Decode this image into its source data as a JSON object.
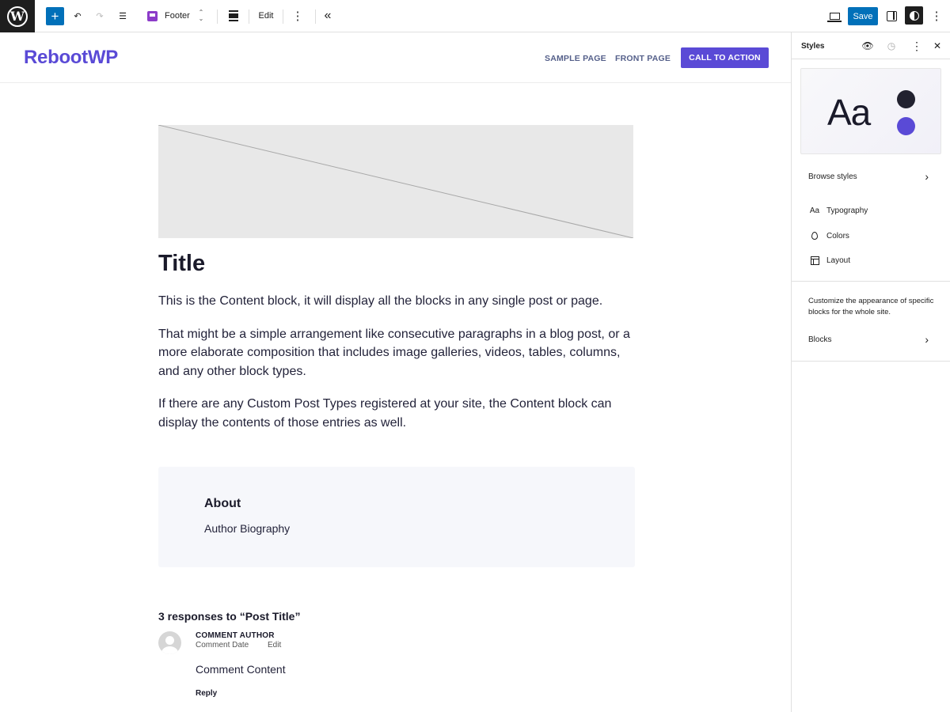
{
  "toolbar": {
    "add_label": "+",
    "undo_icon": "↶",
    "redo_icon": "↷",
    "list_view_icon": "☰",
    "document_title": "Footer",
    "doc_up": "⌃",
    "doc_down": "⌄",
    "edit_label": "Edit",
    "more_icon": "⋮",
    "collapse_icon": "«",
    "save_label": "Save"
  },
  "site": {
    "title": "RebootWP",
    "nav": [
      "SAMPLE PAGE",
      "FRONT PAGE"
    ],
    "cta": "CALL TO ACTION",
    "accent_color": "#5a4ad6"
  },
  "post": {
    "title": "Title",
    "paragraphs": [
      "This is the Content block, it will display all the blocks in any single post or page.",
      "That might be a simple arrangement like consecutive paragraphs in a blog post, or a more elaborate composition that includes image galleries, videos, tables, columns, and any other block types.",
      "If there are any Custom Post Types registered at your site, the Content block can display the contents of those entries as well."
    ]
  },
  "about": {
    "heading": "About",
    "bio": "Author Biography"
  },
  "comments": {
    "heading": "3 responses to “Post Title”",
    "author": "COMMENT AUTHOR",
    "date": "Comment Date",
    "edit": "Edit",
    "content": "Comment Content",
    "reply": "Reply"
  },
  "sidebar": {
    "title": "Styles",
    "eye_icon": "👁",
    "revisions_icon": "◷",
    "more_icon": "⋮",
    "close_icon": "✕",
    "preview_text": "Aa",
    "browse_styles": "Browse styles",
    "chevron": "›",
    "items": [
      {
        "label": "Typography",
        "icon": "typography-icon",
        "glyph": "Aa"
      },
      {
        "label": "Colors",
        "icon": "color-drop-icon"
      },
      {
        "label": "Layout",
        "icon": "layout-icon"
      }
    ],
    "blocks_description": "Customize the appearance of specific blocks for the whole site.",
    "blocks_label": "Blocks",
    "preview_colors": [
      "#222230",
      "#5a4ad6"
    ]
  }
}
